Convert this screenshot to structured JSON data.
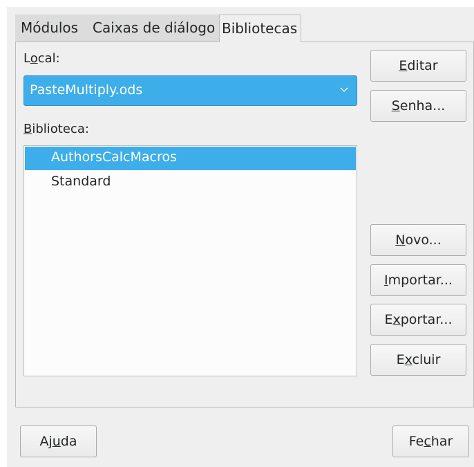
{
  "tabs": [
    {
      "label": "Módulos",
      "active": false
    },
    {
      "label": "Caixas de diálogo",
      "active": false
    },
    {
      "label": "Bibliotecas",
      "active": true
    }
  ],
  "location": {
    "label_prefix": "L",
    "label_underlined": "o",
    "label_suffix": "cal:",
    "selected_value": "PasteMultiply.ods"
  },
  "library": {
    "label_underlined": "B",
    "label_suffix": "iblioteca:",
    "items": [
      {
        "label": "AuthorsCalcMacros",
        "selected": true
      },
      {
        "label": "Standard",
        "selected": false
      }
    ]
  },
  "buttons": {
    "edit": {
      "u": "E",
      "rest": "ditar"
    },
    "password": {
      "u": "S",
      "rest": "enha..."
    },
    "new": {
      "u": "N",
      "rest": "ovo..."
    },
    "import": {
      "u": "I",
      "rest": "mportar..."
    },
    "export": {
      "pre": "E",
      "u": "x",
      "rest": "portar..."
    },
    "delete": {
      "pre": "E",
      "u": "x",
      "rest": "cluir"
    },
    "help": {
      "pre": "Aj",
      "u": "u",
      "rest": "da"
    },
    "close": {
      "pre": "Fe",
      "u": "c",
      "rest": "har"
    }
  },
  "colors": {
    "selection": "#3daee9",
    "dialog_bg": "#efefef"
  }
}
